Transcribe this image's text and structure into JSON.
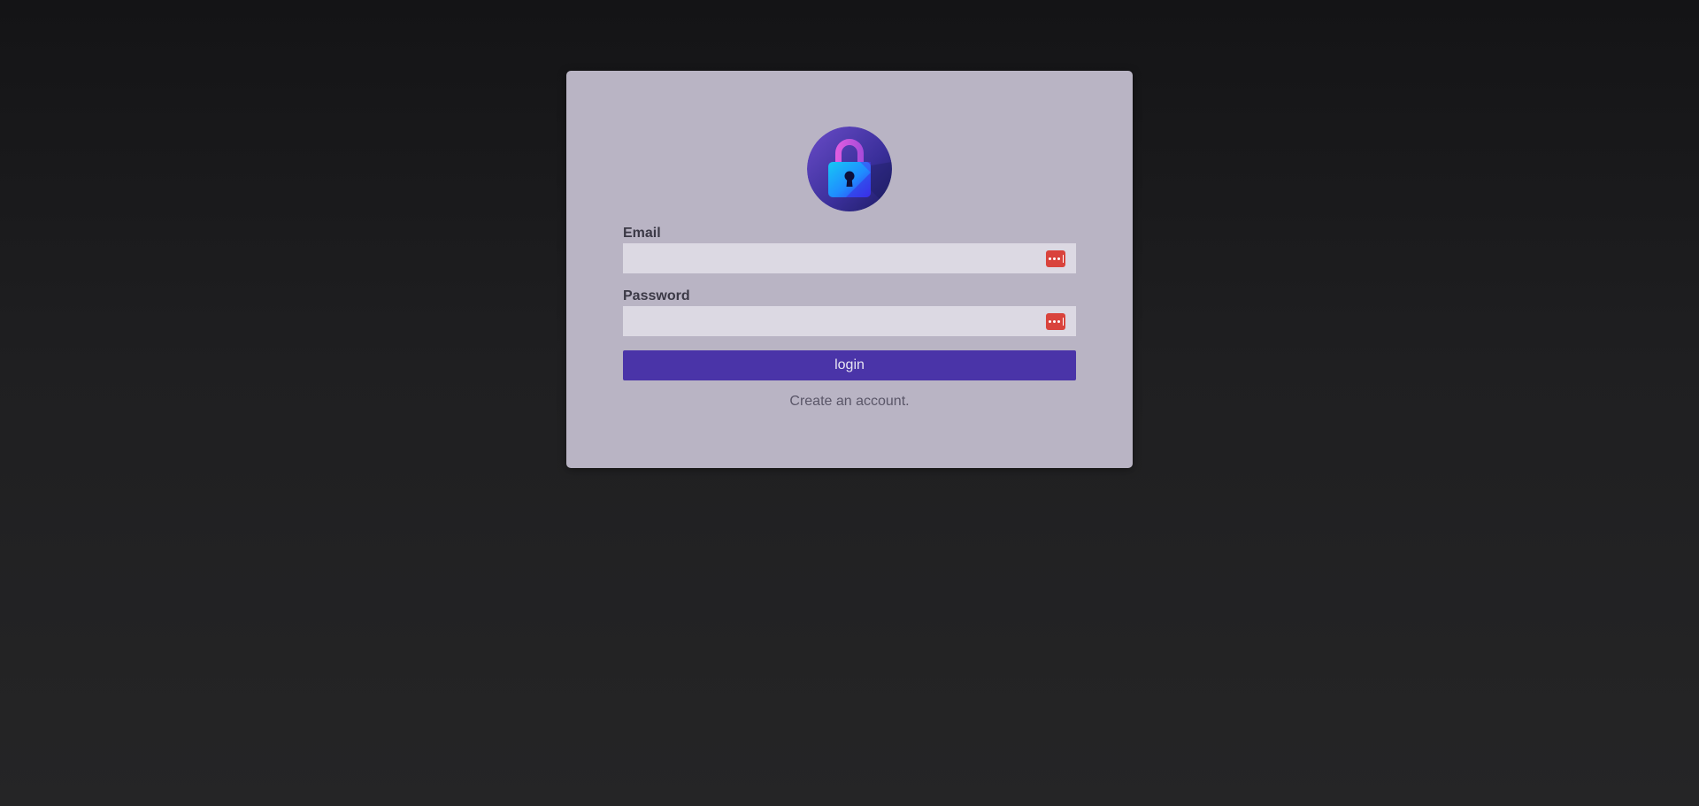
{
  "logo": {
    "icon": "lock-icon"
  },
  "form": {
    "email_label": "Email",
    "email_value": "",
    "email_placeholder": "",
    "password_label": "Password",
    "password_value": "",
    "password_placeholder": "",
    "field_icon": "password-manager-icon",
    "login_label": "login",
    "create_account_link": "Create an account."
  },
  "colors": {
    "background": "#1a1a1c",
    "card": "#b9b4c4",
    "input": "#dcd9e3",
    "button": "#4a34a8",
    "field_icon": "#d9433c"
  }
}
